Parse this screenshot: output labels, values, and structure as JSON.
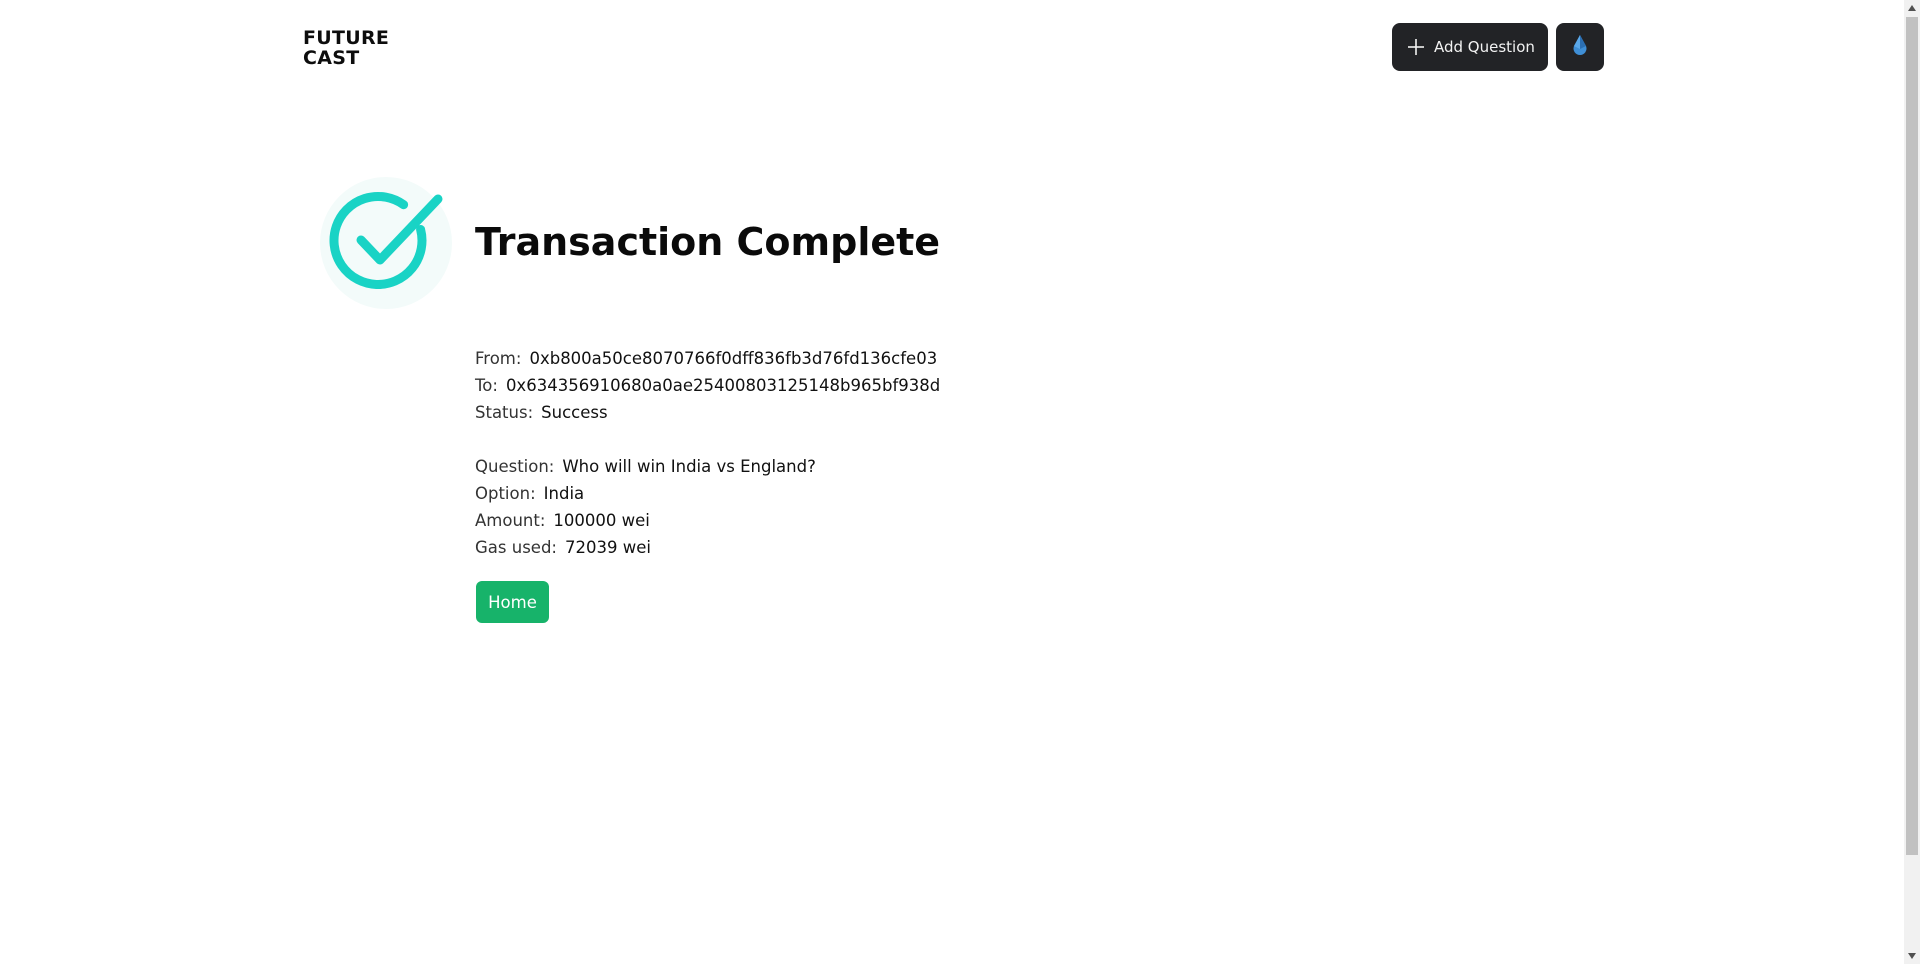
{
  "header": {
    "logo_line1": "FUTURE",
    "logo_line2": "CAST",
    "add_question_label": "Add Question",
    "add_icon": "plus-icon",
    "wallet_icon": "ether-drop-icon"
  },
  "main": {
    "status_icon": "check-circle-icon",
    "title": "Transaction Complete",
    "transaction": [
      {
        "label": "From:",
        "value": "0xb800a50ce8070766f0dff836fb3d76fd136cfe03"
      },
      {
        "label": "To:",
        "value": "0x634356910680a0ae25400803125148b965bf938d"
      },
      {
        "label": "Status:",
        "value": "Success"
      }
    ],
    "bet": [
      {
        "label": "Question:",
        "value": "Who will win India vs England?"
      },
      {
        "label": "Option:",
        "value": "India"
      },
      {
        "label": "Amount:",
        "value": "100000 wei"
      },
      {
        "label": "Gas used:",
        "value": "72039 wei"
      }
    ],
    "home_label": "Home"
  },
  "colors": {
    "accent_teal": "#19d3c5",
    "home_green": "#17b36a",
    "dark_button": "#222326"
  }
}
